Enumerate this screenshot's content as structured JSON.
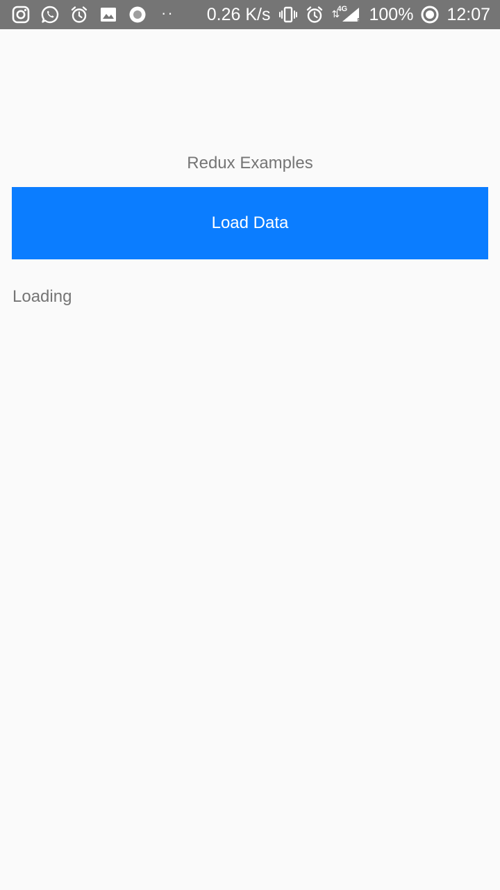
{
  "status_bar": {
    "left_icons": [
      "instagram-icon",
      "whatsapp-icon",
      "alarm-icon",
      "gallery-icon",
      "record-icon"
    ],
    "more_dots": "··",
    "net_speed": "0.26 K/s",
    "network_type": "4G",
    "roaming_indicator": "R",
    "battery": "100%",
    "time": "12:07",
    "background_color": "#757575"
  },
  "main": {
    "title": "Redux Examples",
    "load_button_label": "Load Data",
    "status_text": "Loading",
    "accent_color": "#0b7dff",
    "text_color": "#757575"
  }
}
